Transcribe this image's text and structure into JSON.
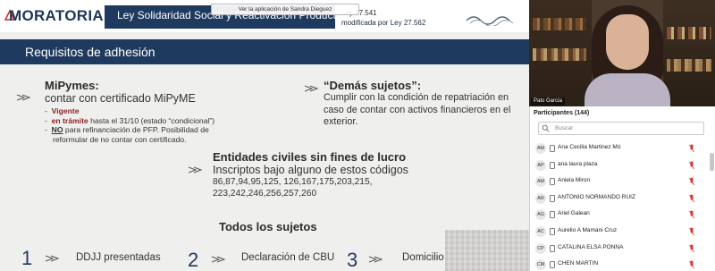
{
  "slide": {
    "logo": "MORATORIA",
    "law_title": "Ley Solidaridad Social y Reactivación Productiva",
    "law_ref_line1": "Ley 27.541",
    "law_ref_line2": "modificada por Ley 27.562",
    "share_banner": "Ver la aplicación de Sandra Dieguez",
    "section_title": "Requisitos de adhesión",
    "mipymes": {
      "heading": "MiPymes:",
      "subheading": "contar con certificado MiPyME",
      "line1": "Vigente",
      "line2_bold": "en trámite",
      "line2_rest": " hasta el 31/10 (estado “condicional”)",
      "line3_bold": "NO",
      "line3_rest": " para refinanciación de PFP. Posibilidad de",
      "line4": "reformular de no contar con certificado."
    },
    "demas": {
      "heading": "“Demás sujetos”:",
      "line1": "Cumplir con la condición de repatriación en",
      "line2": "caso de contar con activos financieros en el",
      "line3": "exterior."
    },
    "entidades": {
      "heading": "Entidades civiles sin fines de lucro",
      "line1": "Inscriptos bajo alguno de estos códigos",
      "line2": "86,87,94,95,125, 126,167,175,203,215,",
      "line3": "223,242,246,256,257,260"
    },
    "todos_heading": "Todos los sujetos",
    "steps": [
      {
        "num": "1",
        "label": "DDJJ presentadas"
      },
      {
        "num": "2",
        "label": "Declaración de CBU"
      },
      {
        "num": "3",
        "label": "Domicilio"
      }
    ]
  },
  "video": {
    "name": "Pato García"
  },
  "participants": {
    "header": "Participantes (144)",
    "search_placeholder": "Buscar",
    "list": [
      {
        "initials": "AM",
        "name": "Ana Cecilia Martinez Mó"
      },
      {
        "initials": "AP",
        "name": "ana laura plaza"
      },
      {
        "initials": "AM",
        "name": "Aniela Miron"
      },
      {
        "initials": "AR",
        "name": "ANTONIO NORMANDO RUIZ"
      },
      {
        "initials": "AG",
        "name": "Ariel Galean"
      },
      {
        "initials": "AC",
        "name": "Aurelio A Mamani Cruz"
      },
      {
        "initials": "CP",
        "name": "CATALINA ELSA PONNA"
      },
      {
        "initials": "CM",
        "name": "CHEN MARTIN"
      }
    ]
  },
  "colors": {
    "navy": "#1f3a5f",
    "slide_bg": "#efefee",
    "mic_red": "#d43a2f"
  }
}
